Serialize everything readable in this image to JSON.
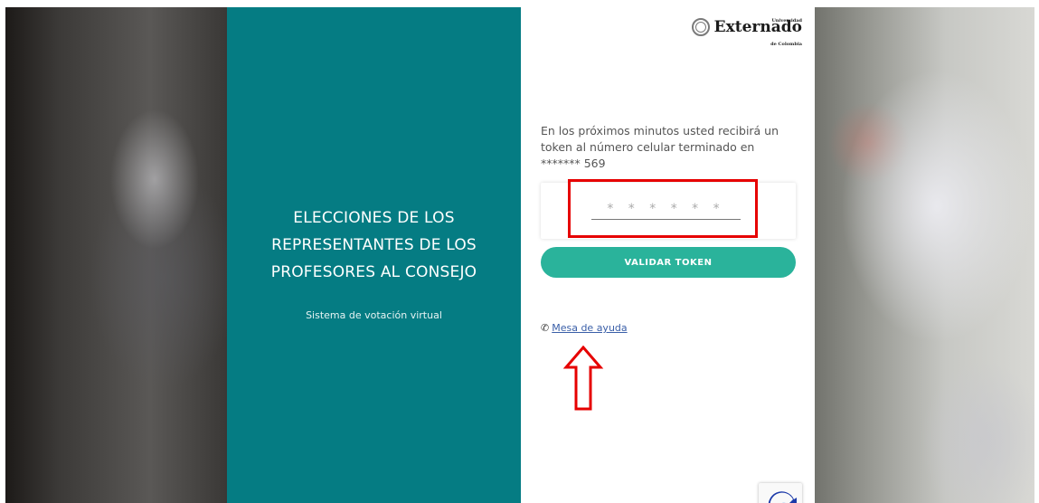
{
  "left_panel": {
    "title_line1": "ELECCIONES DE LOS",
    "title_line2": "REPRESENTANTES DE LOS",
    "title_line3": "PROFESORES AL CONSEJO",
    "subtitle": "Sistema de votación virtual"
  },
  "logo": {
    "top": "Universidad",
    "name": "Externado",
    "bottom": "de Colombia"
  },
  "token_form": {
    "message_line1": "En los próximos minutos usted recibirá un",
    "message_line2": "token al número celular terminado en",
    "message_line3": "******* 569",
    "placeholder": "* * * * * *",
    "button_label": "VALIDAR TOKEN"
  },
  "help": {
    "icon": "phone-icon",
    "link_label": "Mesa de ayuda"
  },
  "annotations": {
    "highlight_color": "#e60000"
  },
  "colors": {
    "panel_teal": "#057c83",
    "button_green": "#2ab39b"
  }
}
